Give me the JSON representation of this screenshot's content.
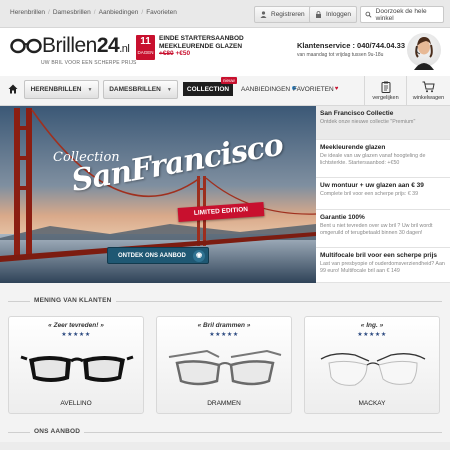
{
  "topbar": {
    "links": [
      "Herenbrillen",
      "Damesbrillen",
      "Aanbiedingen",
      "Favorieten"
    ],
    "register_label": "Registreren",
    "login_label": "Inloggen",
    "search_placeholder": "Doorzoek de hele winkel"
  },
  "header": {
    "logo_name": "Brillen",
    "logo_number": "24",
    "logo_tld": ".nl",
    "tagline": "UW BRIL VOOR EEN SCHERPE PRIJS",
    "starter": {
      "days_number": "11",
      "days_label": "DAGEN",
      "line1": "EINDE STARTERSAANBOD",
      "line2": "MEEKLEURENDE GLAZEN",
      "old_price": "+€80",
      "new_price": "+€50"
    },
    "service_label": "Klantenservice : 040/744.04.33",
    "hours": "van maandag tot vrijdag tussen 9u-18u"
  },
  "nav": {
    "herenbrillen_label": "HERENBRILLEN",
    "damesbrillen_label": "DAMESBRILLEN",
    "collection_label": "COLLECTION",
    "nieuw_badge": "nieuw",
    "aanbiedingen_label": "AANBIEDINGEN",
    "favorieten_label": "FAVORIETEN",
    "vergelijken_label": "vergelijken",
    "winkelwagen_label": "winkelwagen"
  },
  "hero": {
    "collection_word": "Collection",
    "city_word": "SanFrancisco",
    "ribbon": "LIMITED EDITION",
    "cta_label": "ONTDEK ONS AANBOD"
  },
  "side_panel": [
    {
      "title": "San Francisco Collectie",
      "desc": "Ontdek onze nieuwe collectie \"Premium\""
    },
    {
      "title": "Meekleurende glazen",
      "desc": "De ideale van uw glazen vanaf hoogteling de lichtsterkte. Startersaanbod: +€50"
    },
    {
      "title": "Uw montuur + uw glazen aan € 39",
      "desc": "Complete bril voor een scherpe prijs: € 39"
    },
    {
      "title": "Garantie 100%",
      "desc": "Bent u niet tevreden over uw bril ? Uw bril wordt omgeruild of terugbetaald binnen 30 dagen!"
    },
    {
      "title": "Multifocale bril voor een scherpe prijs",
      "desc": "Last van presbyopie of ouderdomsverziendheid? Aan 99 euro! Multifocale bril aan € 149"
    }
  ],
  "reviews": {
    "section_title": "MENING VAN KLANTEN",
    "items": [
      {
        "quote": "« Zeer tevreden! »",
        "stars": "★★★★★",
        "model": "AVELLINO"
      },
      {
        "quote": "« Bril drammen »",
        "stars": "★★★★★",
        "model": "DRAMMEN"
      },
      {
        "quote": "« Ing. »",
        "stars": "★★★★★",
        "model": "MACKAY"
      }
    ]
  },
  "offer": {
    "section_title": "ONS AANBOD"
  },
  "colors": {
    "accent_red": "#c8102e",
    "button_blue": "#1f5873",
    "star_blue": "#2c4a80"
  }
}
